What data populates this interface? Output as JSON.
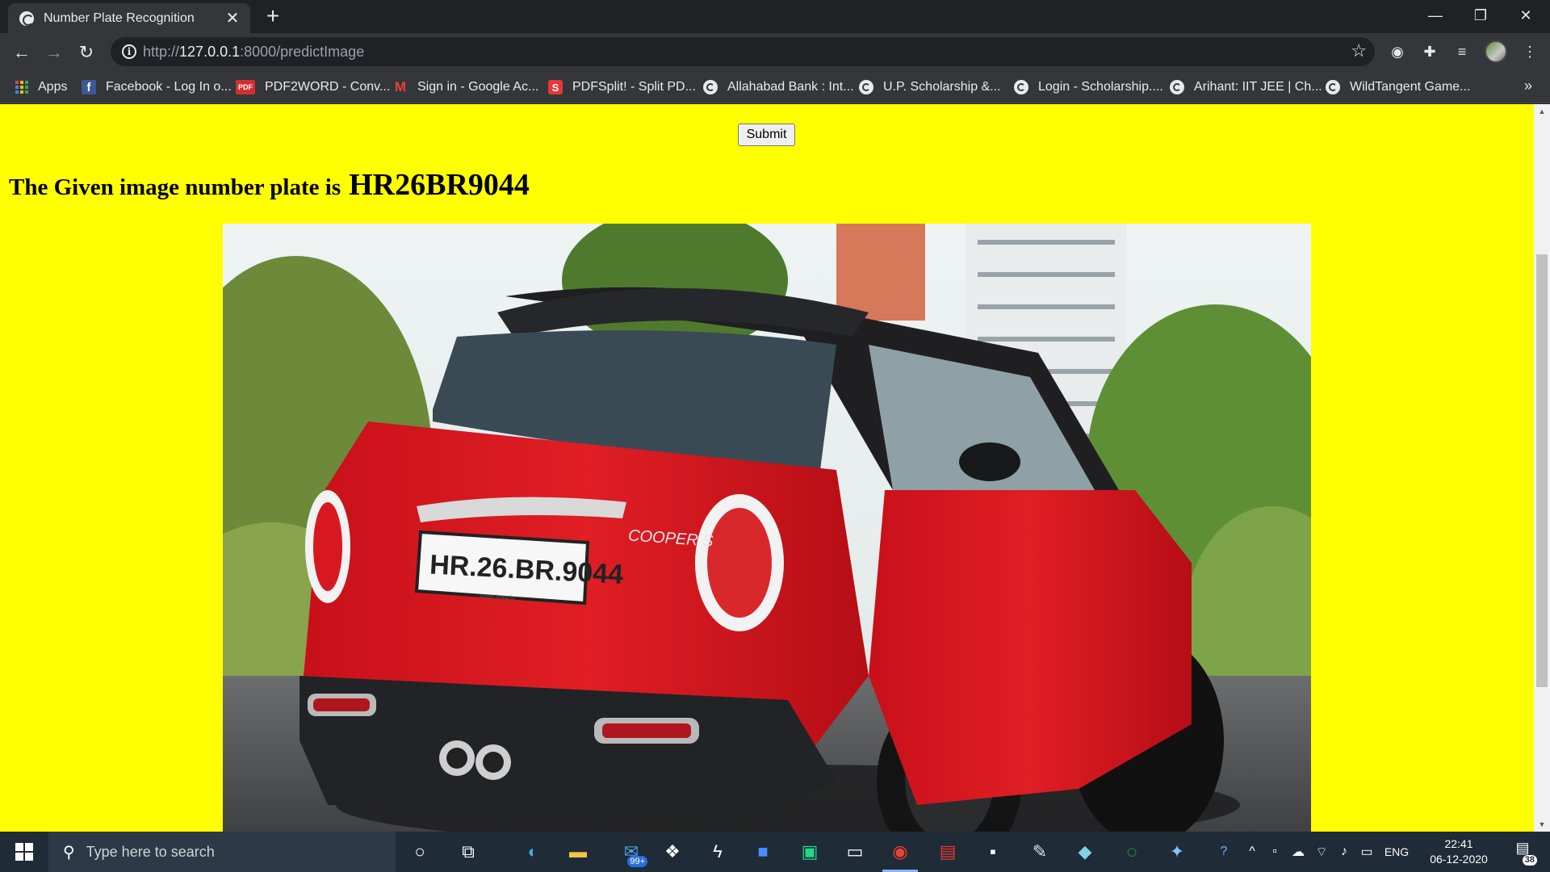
{
  "browser": {
    "tab_title": "Number Plate Recognition",
    "tab_close": "✕",
    "new_tab": "+",
    "url_scheme": "http://",
    "url_host": "127.0.0.1",
    "url_path": ":8000/predictImage",
    "window_controls": {
      "minimize": "—",
      "restore": "❐",
      "close": "✕"
    }
  },
  "bookmarks": [
    {
      "label": "Apps",
      "icon": "apps-grid-icon"
    },
    {
      "label": "Facebook - Log In o...",
      "icon": "facebook-icon"
    },
    {
      "label": "PDF2WORD - Conv...",
      "icon": "pdf-icon",
      "icon_text": "PDF"
    },
    {
      "label": "Sign in - Google Ac...",
      "icon": "gmail-icon"
    },
    {
      "label": "PDFSplit! - Split PD...",
      "icon": "pdfsplit-icon",
      "icon_text": "S"
    },
    {
      "label": "Allahabad Bank : Int...",
      "icon": "globe-icon"
    },
    {
      "label": "U.P. Scholarship &...",
      "icon": "globe-icon"
    },
    {
      "label": "Login - Scholarship....",
      "icon": "globe-icon"
    },
    {
      "label": "Arihant: IIT JEE | Ch...",
      "icon": "globe-icon"
    },
    {
      "label": "WildTangent Game...",
      "icon": "globe-icon"
    }
  ],
  "page": {
    "submit_label": "Submit",
    "result_lead": "The Given image number plate is",
    "plate_number": "HR26BR9044",
    "photo": {
      "plate_text": "HR.26.BR.9044",
      "badge_text": "COOPER S",
      "plate_subtext": "www.bmw.in"
    }
  },
  "taskbar": {
    "search_placeholder": "Type here to search",
    "mail_badge": "99+",
    "language": "ENG",
    "time": "22:41",
    "date": "06-12-2020",
    "notification_count": "38"
  },
  "colors": {
    "page_background": "#ffff00",
    "browser_frame": "#202124",
    "toolbar": "#35363a",
    "taskbar": "#1f2b37"
  }
}
